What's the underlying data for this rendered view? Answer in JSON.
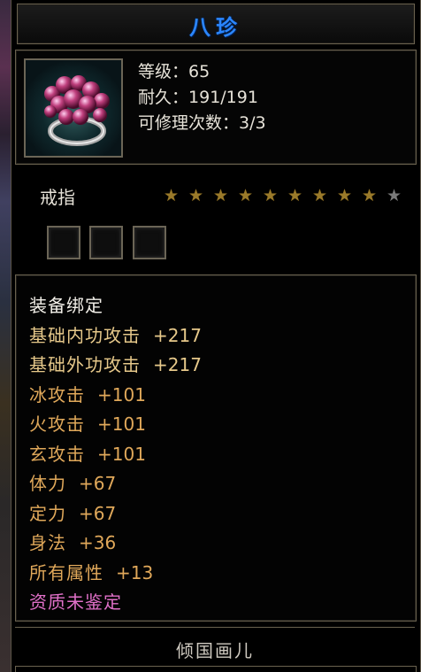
{
  "item": {
    "name": "八珍",
    "name_color": "#2b86ff",
    "icon": "pink-pearl-cluster-ring-icon",
    "stats": [
      {
        "label": "等级：",
        "value": "65"
      },
      {
        "label": "耐久：",
        "value": "191/191"
      },
      {
        "label": "可修理次数：",
        "value": "3/3"
      }
    ],
    "type": "戒指",
    "stars": {
      "filled": 9,
      "total": 10
    },
    "sockets": 3,
    "attributes": [
      {
        "name": "装备绑定",
        "value": "",
        "color": "#f2efe8"
      },
      {
        "name": "基础内功攻击",
        "value": "+217",
        "color": "#e6c88a"
      },
      {
        "name": "基础外功攻击",
        "value": "+217",
        "color": "#e6c88a"
      },
      {
        "name": "冰攻击",
        "value": "+101",
        "color": "#e0a85a"
      },
      {
        "name": "火攻击",
        "value": "+101",
        "color": "#e0a85a"
      },
      {
        "name": "玄攻击",
        "value": "+101",
        "color": "#e0a85a"
      },
      {
        "name": "体力",
        "value": "+67",
        "color": "#e0a85a"
      },
      {
        "name": "定力",
        "value": "+67",
        "color": "#e0a85a"
      },
      {
        "name": "身法",
        "value": "+36",
        "color": "#e0a85a"
      },
      {
        "name": "所有属性",
        "value": "+13",
        "color": "#e0a85a"
      },
      {
        "name": "资质未鉴定",
        "value": "",
        "color": "#e070c8"
      }
    ],
    "owner": "倾国画儿"
  }
}
